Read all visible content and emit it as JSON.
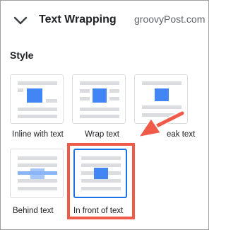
{
  "panel": {
    "section_title": "Text Wrapping",
    "watermark": "groovyPost.com",
    "style_label": "Style"
  },
  "wrap_options": [
    {
      "label": "Inline with text",
      "selected": false
    },
    {
      "label": "Wrap text",
      "selected": false
    },
    {
      "label": "Break text",
      "visible_label": "eak text",
      "selected": false
    },
    {
      "label": "Behind text",
      "selected": false
    },
    {
      "label": "In front of text",
      "selected": true
    }
  ],
  "colors": {
    "accent": "#1a73e8",
    "image_blue": "#4285f4",
    "line_gray": "#dadce0",
    "highlight_red": "#ef5a49"
  },
  "icons": [
    "chevron-down-icon"
  ]
}
